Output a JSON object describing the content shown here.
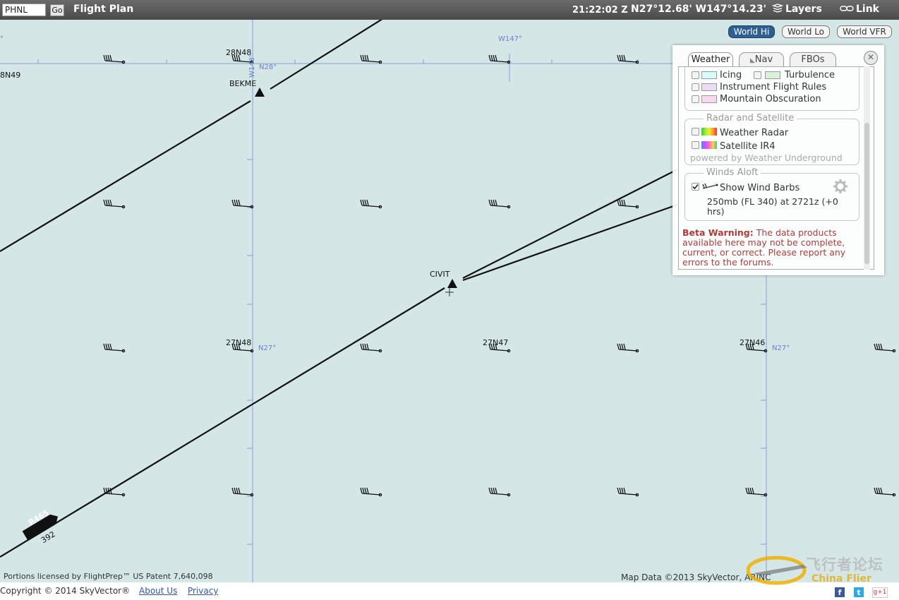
{
  "toolbar": {
    "airport_input_value": "PHNL",
    "go_label": "Go",
    "flight_plan_label": "Flight Plan",
    "time": "21:22:02 Z",
    "coordinates": "N27°12.68' W147°14.23'",
    "layers_label": "Layers",
    "link_label": "Link"
  },
  "chart_buttons": {
    "world_hi": "World Hi",
    "world_lo": "World Lo",
    "world_vfr": "World VFR",
    "selected": "World Hi"
  },
  "map": {
    "waypoints": [
      "BEKME",
      "CIVIT"
    ],
    "grid_points": [
      "28N48",
      "27N48",
      "27N47",
      "27N46",
      "8N49"
    ],
    "grid_labels": {
      "w148": "W148°",
      "w147": "W147°",
      "n28": "N28°",
      "n27a": "N27°",
      "n27b": "N27°",
      "edge_deg": "°"
    },
    "airway": {
      "name": "R465",
      "course": "392"
    },
    "patent_note": "Portions licensed by FlightPrep™ US Patent 7,640,098",
    "data_credit": "Map Data ©2013 SkyVector, ARINC"
  },
  "layers_panel": {
    "tabs": [
      "Weather",
      "Nav",
      "FBOs"
    ],
    "active_tab": "Weather",
    "close_label": "✕",
    "advisories": [
      {
        "label": "Icing",
        "color": "#d8fbfb",
        "checked": false
      },
      {
        "label": "Turbulence",
        "color": "#d9f2d9",
        "checked": false
      },
      {
        "label": "Instrument Flight Rules",
        "color": "#ecdcf5",
        "checked": false
      },
      {
        "label": "Mountain Obscuration",
        "color": "#f8daf0",
        "checked": false
      }
    ],
    "radar_group": {
      "title": "Radar and Satellite",
      "weather_radar": "Weather Radar",
      "satellite": "Satellite IR4",
      "powered_by": "powered by Weather Underground"
    },
    "winds_group": {
      "title": "Winds Aloft",
      "show_wind_barbs": "Show Wind Barbs",
      "checked": true,
      "level_line1": "250mb (FL 340) at 2721z (+0",
      "level_line2": "hrs)"
    },
    "beta_warning": {
      "title": "Beta Warning:",
      "text": " The data products available here may not be complete, current, or correct. Please report any errors to the forums."
    }
  },
  "footer": {
    "copyright": "Copyright © 2014 SkyVector®",
    "about_link": "About Us",
    "privacy_link": "Privacy",
    "watermark_cn": "飞行者论坛",
    "watermark_en": "China Flier"
  },
  "colors": {
    "map_background": "#d4e6e6",
    "grid_line": "#8a9ddb",
    "route": "#111111",
    "button_active": "#2e5f92",
    "beta_warning": "#b23a3a"
  }
}
